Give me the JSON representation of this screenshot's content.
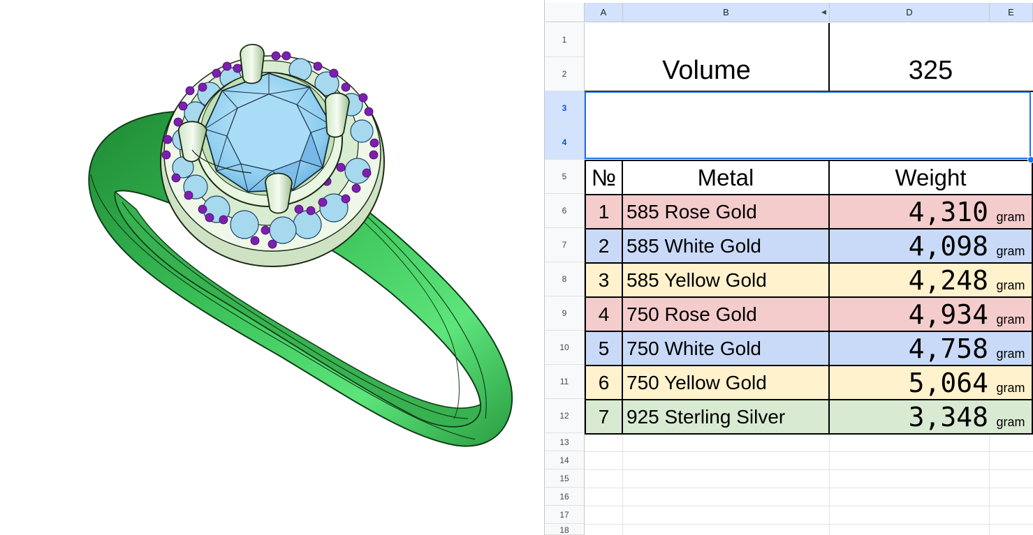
{
  "spreadsheet": {
    "columns": [
      "A",
      "B",
      "D",
      "E"
    ],
    "rows": [
      "1",
      "2",
      "3",
      "4",
      "5",
      "6",
      "7",
      "8",
      "9",
      "10",
      "11",
      "12",
      "13",
      "14",
      "15",
      "16",
      "17",
      "18"
    ],
    "volume_label": "Volume",
    "volume_value": "325",
    "table_header": {
      "num": "№",
      "metal": "Metal",
      "weight": "Weight"
    },
    "table_rows": [
      {
        "num": "1",
        "metal": "585 Rose Gold",
        "weight": "4,310",
        "unit": "gram",
        "color": "#f4cccc"
      },
      {
        "num": "2",
        "metal": "585 White Gold",
        "weight": "4,098",
        "unit": "gram",
        "color": "#c9daf8"
      },
      {
        "num": "3",
        "metal": "585 Yellow Gold",
        "weight": "4,248",
        "unit": "gram",
        "color": "#fff2cc"
      },
      {
        "num": "4",
        "metal": "750 Rose Gold",
        "weight": "4,934",
        "unit": "gram",
        "color": "#f4cccc"
      },
      {
        "num": "5",
        "metal": "750 White Gold",
        "weight": "4,758",
        "unit": "gram",
        "color": "#c9daf8"
      },
      {
        "num": "6",
        "metal": "750 Yellow Gold",
        "weight": "5,064",
        "unit": "gram",
        "color": "#fff2cc"
      },
      {
        "num": "7",
        "metal": "925 Sterling Silver",
        "weight": "3,348",
        "unit": "gram",
        "color": "#d9ead3"
      }
    ],
    "selection_color": "#1a73e8"
  },
  "render": {
    "icon": "ring-3d-model",
    "band_color": "#3fbf5a",
    "setting_color": "#e4f2dc",
    "center_stone_color": "#9fd8f3",
    "halo_stone_color": "#a6d8ee",
    "accent_stone_color": "#7d1fb0"
  }
}
